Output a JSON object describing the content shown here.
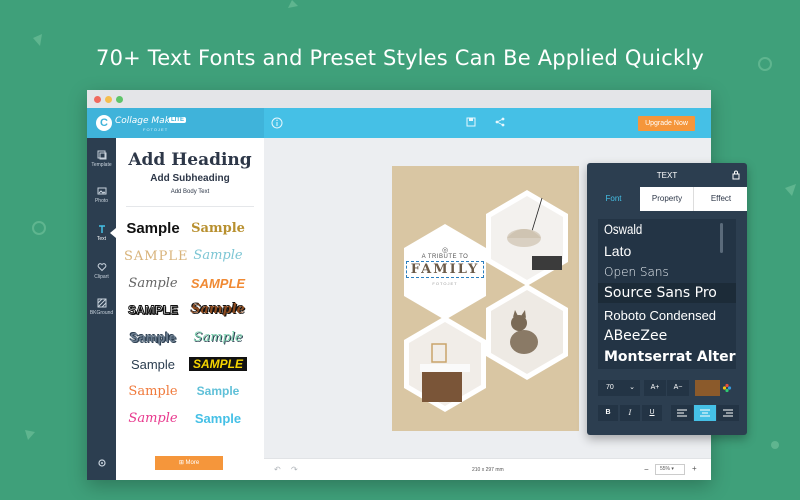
{
  "headline": "70+ Text Fonts and Preset Styles Can Be Applied Quickly",
  "app": {
    "brand": "Collage Maker",
    "lite_badge": "LITE",
    "fotojet": "FOTOJET",
    "upgrade_label": "Upgrade Now"
  },
  "sidebar": {
    "items": [
      {
        "label": "Template",
        "icon": "template-icon"
      },
      {
        "label": "Photo",
        "icon": "photo-icon"
      },
      {
        "label": "Text",
        "icon": "text-icon"
      },
      {
        "label": "Clipart",
        "icon": "heart-icon"
      },
      {
        "label": "BKGround",
        "icon": "background-icon"
      }
    ],
    "settings_icon": "gear-icon"
  },
  "text_panel": {
    "add_heading": "Add Heading",
    "add_subheading": "Add Subheading",
    "add_body": "Add Body Text",
    "samples": [
      "Sample",
      "Sample",
      "SAMPLE",
      "Sample",
      "Sample",
      "SAMPLE",
      "SAMPLE",
      "Sample",
      "Sample",
      "Sample",
      "Sample",
      "SAMPLE",
      "Sample",
      "Sample",
      "Sample",
      "Sample"
    ],
    "more_label": "More"
  },
  "poster": {
    "tribute": "A TRIBUTE TO",
    "family": "FAMILY",
    "fotojet": "FOTOJET"
  },
  "bottom": {
    "size": "210 x 297 mm",
    "zoom": "55%"
  },
  "text_tool": {
    "title": "TEXT",
    "tabs": [
      "Font",
      "Property",
      "Effect"
    ],
    "active_tab": "Font",
    "fonts": [
      "Oswald",
      "Lato",
      "Open Sans",
      "Source Sans Pro",
      "Roboto Condensed",
      "ABeeZee",
      "Montserrat Alternates"
    ],
    "selected_font": "Source Sans Pro",
    "font_size": "70",
    "increase": "A+",
    "decrease": "A−",
    "bold": "B",
    "italic": "I",
    "underline": "U",
    "text_color": "#8b5a2b",
    "active_align": "center"
  },
  "colors": {
    "background": "#3fa07a",
    "app_blue": "#45c0e6",
    "sidebar": "#2c3e50",
    "accent_orange": "#f5963b"
  }
}
